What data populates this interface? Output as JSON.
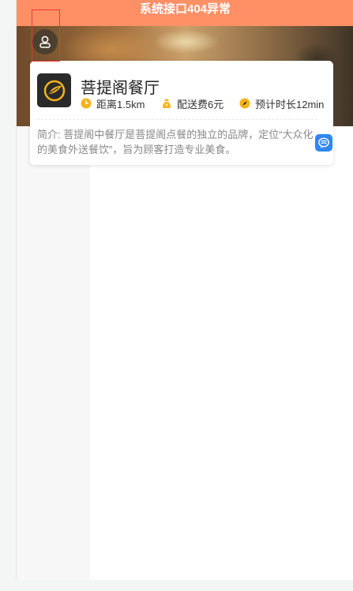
{
  "error_bar": {
    "text": "系统接口404异常"
  },
  "banner": {
    "avatar_icon": "user-icon"
  },
  "shop": {
    "name": "菩提阁餐厅",
    "logo_icon": "restaurant-logo",
    "distance": "距离1.5km",
    "delivery_fee": "配送费6元",
    "eta": "预计时长12min",
    "intro": "简介: 菩提阁中餐厅是菩提阁点餐的独立的品牌，定位“大众化的美食外送餐饮”，旨为顾客打造专业美食。",
    "chat_icon": "chat-icon"
  },
  "colors": {
    "error_bar": "#ff9066",
    "accent_yellow": "#f5b31b",
    "chat_blue": "#2f87f3"
  }
}
